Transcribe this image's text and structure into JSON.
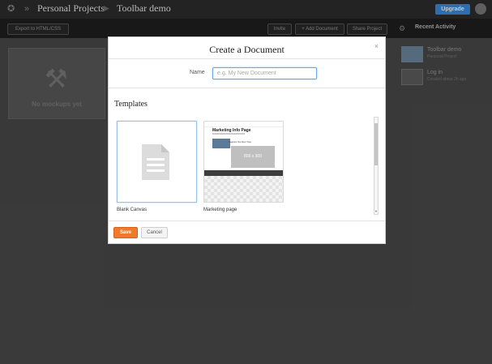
{
  "topbar": {
    "breadcrumb": [
      "Personal Projects",
      "Toolbar demo"
    ],
    "upgrade_label": "Upgrade"
  },
  "toolbar": {
    "export_label": "Export to HTML/CSS",
    "invite_label": "Invite",
    "add_document_label": "+ Add Document",
    "share_label": "Share Project",
    "recent_activity_label": "Recent Activity"
  },
  "main": {
    "empty_card_text": "No mockups yet"
  },
  "activity": [
    {
      "title": "Toolbar demo",
      "subtitle": "Personal Project"
    },
    {
      "title": "Log in",
      "subtitle": "Created about 2h ago"
    }
  ],
  "modal": {
    "title": "Create a Document",
    "close_glyph": "×",
    "name_label": "Name",
    "name_placeholder": "e.g. My New Document",
    "name_value": "",
    "templates_title": "Templates",
    "templates": [
      {
        "name": "Blank Canvas",
        "selected": true
      },
      {
        "name": "Marketing page",
        "selected": false
      }
    ],
    "marketing_preview": {
      "title": "Marketing Info Page",
      "feature_label": "Feature Number Two",
      "placeholder": "800 x 300"
    },
    "save_label": "Save",
    "cancel_label": "Cancel"
  },
  "colors": {
    "accent_orange": "#f07a2b",
    "upgrade_blue": "#3b8de0"
  }
}
